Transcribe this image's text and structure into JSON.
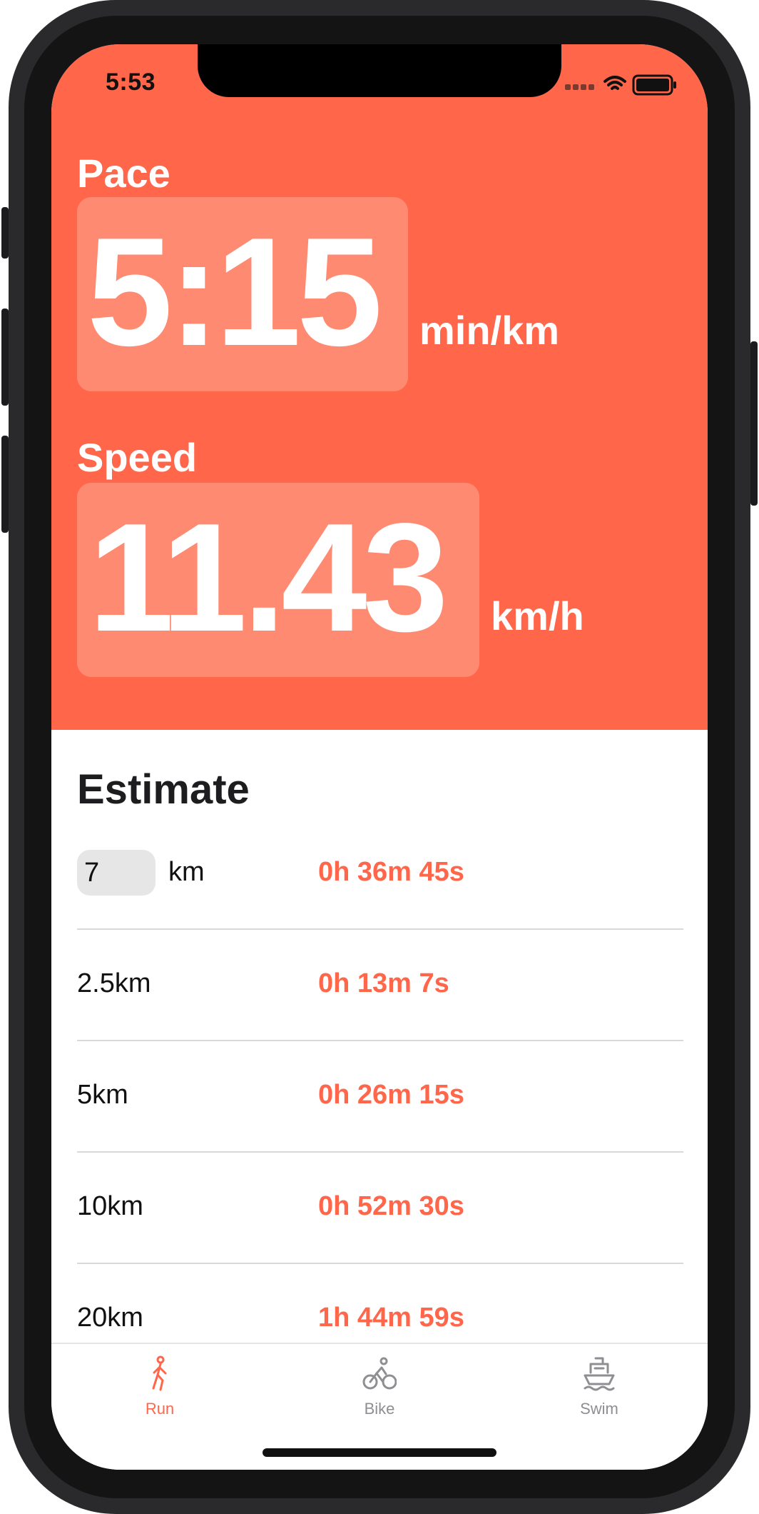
{
  "status_bar": {
    "time": "5:53"
  },
  "pace": {
    "label": "Pace",
    "value": "5:15",
    "unit": "min/km"
  },
  "speed": {
    "label": "Speed",
    "value": "11.43",
    "unit": "km/h"
  },
  "estimate": {
    "title": "Estimate",
    "custom": {
      "distance": "7",
      "unit": "km",
      "time": "0h 36m 45s"
    },
    "rows": [
      {
        "label": "2.5km",
        "time": "0h 13m 7s"
      },
      {
        "label": "5km",
        "time": "0h 26m 15s"
      },
      {
        "label": "10km",
        "time": "0h 52m 30s"
      },
      {
        "label": "20km",
        "time": "1h 44m 59s"
      }
    ]
  },
  "tabs": [
    {
      "label": "Run",
      "icon": "run-icon",
      "active": true
    },
    {
      "label": "Bike",
      "icon": "bike-icon",
      "active": false
    },
    {
      "label": "Swim",
      "icon": "swim-icon",
      "active": false
    }
  ],
  "colors": {
    "accent": "#ff664a",
    "value_box": "#ff8a72",
    "inactive": "#8e8e93"
  }
}
